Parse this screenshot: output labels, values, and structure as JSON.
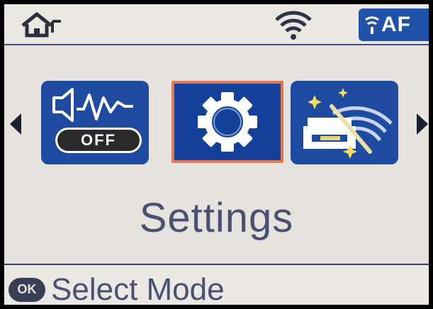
{
  "status_bar": {
    "home_icon": "home-icon",
    "wifi_icon": "wifi-signal-icon",
    "af_badge": {
      "text": "AF",
      "icon": "wifi-direct-icon",
      "color": "#1f52a8"
    }
  },
  "mode_tiles": [
    {
      "id": "sound",
      "icon": "speaker-waveform-icon",
      "badge": "OFF",
      "selected": false
    },
    {
      "id": "settings",
      "icon": "gear-icon",
      "selected": true
    },
    {
      "id": "wifi-setup",
      "icon": "wifi-setup-wand-icon",
      "selected": false
    }
  ],
  "navigation": {
    "left_arrow": "left-arrow-icon",
    "right_arrow": "right-arrow-icon"
  },
  "selected_mode_label": "Settings",
  "footer": {
    "ok_label": "OK",
    "hint": "Select Mode"
  },
  "colors": {
    "tile_blue": "#1e4aa0",
    "selection_border": "#e07a55",
    "text": "#4a5070",
    "background": "#e6e2dd"
  }
}
